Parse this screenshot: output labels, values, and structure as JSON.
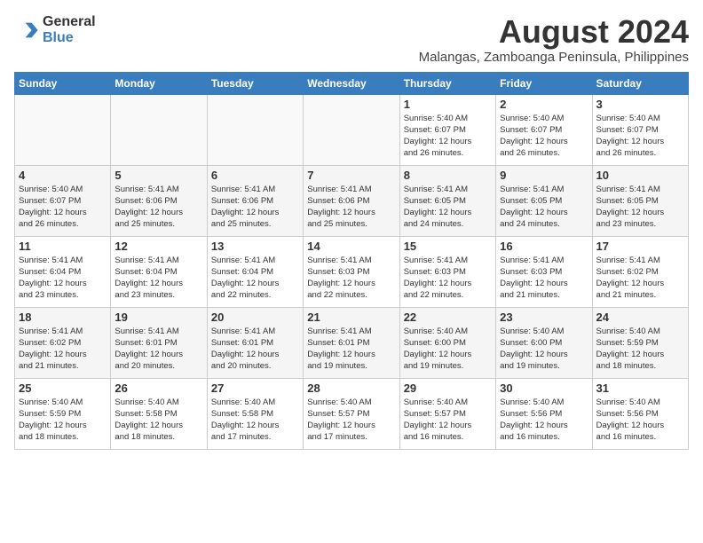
{
  "header": {
    "logo_general": "General",
    "logo_blue": "Blue",
    "month_year": "August 2024",
    "location": "Malangas, Zamboanga Peninsula, Philippines"
  },
  "calendar": {
    "days_of_week": [
      "Sunday",
      "Monday",
      "Tuesday",
      "Wednesday",
      "Thursday",
      "Friday",
      "Saturday"
    ],
    "weeks": [
      [
        {
          "day": "",
          "info": ""
        },
        {
          "day": "",
          "info": ""
        },
        {
          "day": "",
          "info": ""
        },
        {
          "day": "",
          "info": ""
        },
        {
          "day": "1",
          "info": "Sunrise: 5:40 AM\nSunset: 6:07 PM\nDaylight: 12 hours\nand 26 minutes."
        },
        {
          "day": "2",
          "info": "Sunrise: 5:40 AM\nSunset: 6:07 PM\nDaylight: 12 hours\nand 26 minutes."
        },
        {
          "day": "3",
          "info": "Sunrise: 5:40 AM\nSunset: 6:07 PM\nDaylight: 12 hours\nand 26 minutes."
        }
      ],
      [
        {
          "day": "4",
          "info": "Sunrise: 5:40 AM\nSunset: 6:07 PM\nDaylight: 12 hours\nand 26 minutes."
        },
        {
          "day": "5",
          "info": "Sunrise: 5:41 AM\nSunset: 6:06 PM\nDaylight: 12 hours\nand 25 minutes."
        },
        {
          "day": "6",
          "info": "Sunrise: 5:41 AM\nSunset: 6:06 PM\nDaylight: 12 hours\nand 25 minutes."
        },
        {
          "day": "7",
          "info": "Sunrise: 5:41 AM\nSunset: 6:06 PM\nDaylight: 12 hours\nand 25 minutes."
        },
        {
          "day": "8",
          "info": "Sunrise: 5:41 AM\nSunset: 6:05 PM\nDaylight: 12 hours\nand 24 minutes."
        },
        {
          "day": "9",
          "info": "Sunrise: 5:41 AM\nSunset: 6:05 PM\nDaylight: 12 hours\nand 24 minutes."
        },
        {
          "day": "10",
          "info": "Sunrise: 5:41 AM\nSunset: 6:05 PM\nDaylight: 12 hours\nand 23 minutes."
        }
      ],
      [
        {
          "day": "11",
          "info": "Sunrise: 5:41 AM\nSunset: 6:04 PM\nDaylight: 12 hours\nand 23 minutes."
        },
        {
          "day": "12",
          "info": "Sunrise: 5:41 AM\nSunset: 6:04 PM\nDaylight: 12 hours\nand 23 minutes."
        },
        {
          "day": "13",
          "info": "Sunrise: 5:41 AM\nSunset: 6:04 PM\nDaylight: 12 hours\nand 22 minutes."
        },
        {
          "day": "14",
          "info": "Sunrise: 5:41 AM\nSunset: 6:03 PM\nDaylight: 12 hours\nand 22 minutes."
        },
        {
          "day": "15",
          "info": "Sunrise: 5:41 AM\nSunset: 6:03 PM\nDaylight: 12 hours\nand 22 minutes."
        },
        {
          "day": "16",
          "info": "Sunrise: 5:41 AM\nSunset: 6:03 PM\nDaylight: 12 hours\nand 21 minutes."
        },
        {
          "day": "17",
          "info": "Sunrise: 5:41 AM\nSunset: 6:02 PM\nDaylight: 12 hours\nand 21 minutes."
        }
      ],
      [
        {
          "day": "18",
          "info": "Sunrise: 5:41 AM\nSunset: 6:02 PM\nDaylight: 12 hours\nand 21 minutes."
        },
        {
          "day": "19",
          "info": "Sunrise: 5:41 AM\nSunset: 6:01 PM\nDaylight: 12 hours\nand 20 minutes."
        },
        {
          "day": "20",
          "info": "Sunrise: 5:41 AM\nSunset: 6:01 PM\nDaylight: 12 hours\nand 20 minutes."
        },
        {
          "day": "21",
          "info": "Sunrise: 5:41 AM\nSunset: 6:01 PM\nDaylight: 12 hours\nand 19 minutes."
        },
        {
          "day": "22",
          "info": "Sunrise: 5:40 AM\nSunset: 6:00 PM\nDaylight: 12 hours\nand 19 minutes."
        },
        {
          "day": "23",
          "info": "Sunrise: 5:40 AM\nSunset: 6:00 PM\nDaylight: 12 hours\nand 19 minutes."
        },
        {
          "day": "24",
          "info": "Sunrise: 5:40 AM\nSunset: 5:59 PM\nDaylight: 12 hours\nand 18 minutes."
        }
      ],
      [
        {
          "day": "25",
          "info": "Sunrise: 5:40 AM\nSunset: 5:59 PM\nDaylight: 12 hours\nand 18 minutes."
        },
        {
          "day": "26",
          "info": "Sunrise: 5:40 AM\nSunset: 5:58 PM\nDaylight: 12 hours\nand 18 minutes."
        },
        {
          "day": "27",
          "info": "Sunrise: 5:40 AM\nSunset: 5:58 PM\nDaylight: 12 hours\nand 17 minutes."
        },
        {
          "day": "28",
          "info": "Sunrise: 5:40 AM\nSunset: 5:57 PM\nDaylight: 12 hours\nand 17 minutes."
        },
        {
          "day": "29",
          "info": "Sunrise: 5:40 AM\nSunset: 5:57 PM\nDaylight: 12 hours\nand 16 minutes."
        },
        {
          "day": "30",
          "info": "Sunrise: 5:40 AM\nSunset: 5:56 PM\nDaylight: 12 hours\nand 16 minutes."
        },
        {
          "day": "31",
          "info": "Sunrise: 5:40 AM\nSunset: 5:56 PM\nDaylight: 12 hours\nand 16 minutes."
        }
      ]
    ]
  }
}
